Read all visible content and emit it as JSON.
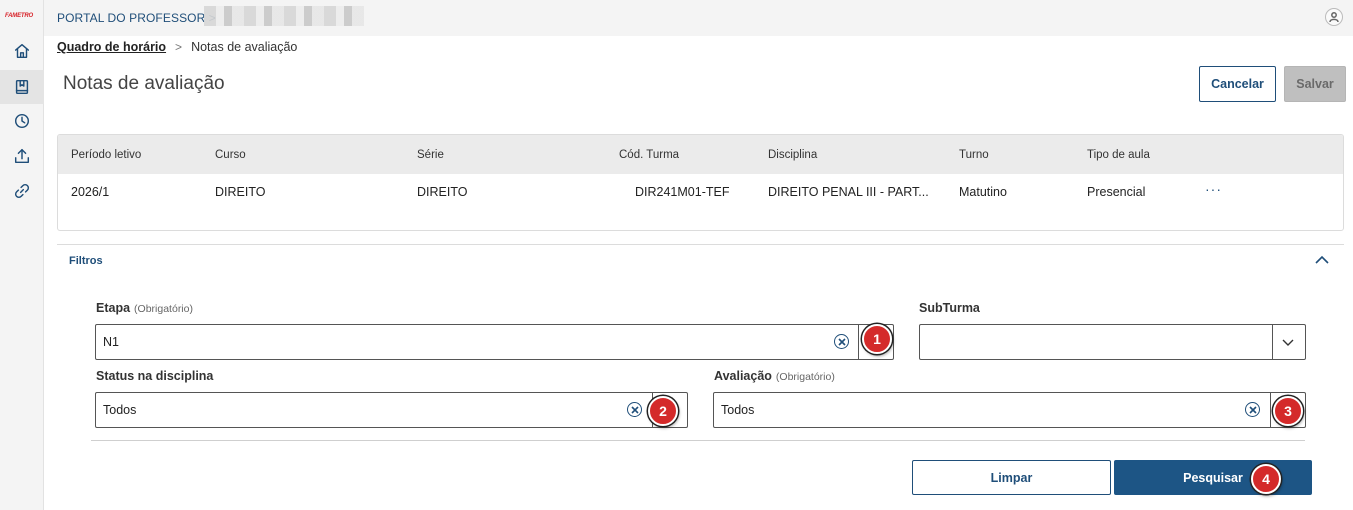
{
  "app": {
    "logo_text": "FAMETRO",
    "portal_title": "PORTAL DO PROFESSOR >"
  },
  "breadcrumb": {
    "link": "Quadro de horário",
    "separator": ">",
    "current": "Notas de avaliação"
  },
  "page": {
    "title": "Notas de avaliação",
    "cancel_label": "Cancelar",
    "save_label": "Salvar"
  },
  "info_table": {
    "headers": [
      "Período letivo",
      "Curso",
      "Série",
      "Cód. Turma",
      "Disciplina",
      "Turno",
      "Tipo de aula"
    ],
    "row": [
      "2026/1",
      "DIREITO",
      "DIREITO",
      "DIR241M01-TEF",
      "DIREITO PENAL III - PART...",
      "Matutino",
      "Presencial"
    ],
    "more_label": "···"
  },
  "filters": {
    "title": "Filtros",
    "etapa": {
      "label": "Etapa",
      "required": "(Obrigatório)",
      "value": "N1"
    },
    "subturma": {
      "label": "SubTurma",
      "value": ""
    },
    "status": {
      "label": "Status na disciplina",
      "value": "Todos"
    },
    "avaliacao": {
      "label": "Avaliação",
      "required": "(Obrigatório)",
      "value": "Todos"
    },
    "clear_label": "Limpar",
    "search_label": "Pesquisar"
  },
  "annotations": [
    "1",
    "2",
    "3",
    "4"
  ],
  "colors": {
    "primary": "#1d5585",
    "badge": "#d42a2a",
    "logo": "#d8232a"
  }
}
